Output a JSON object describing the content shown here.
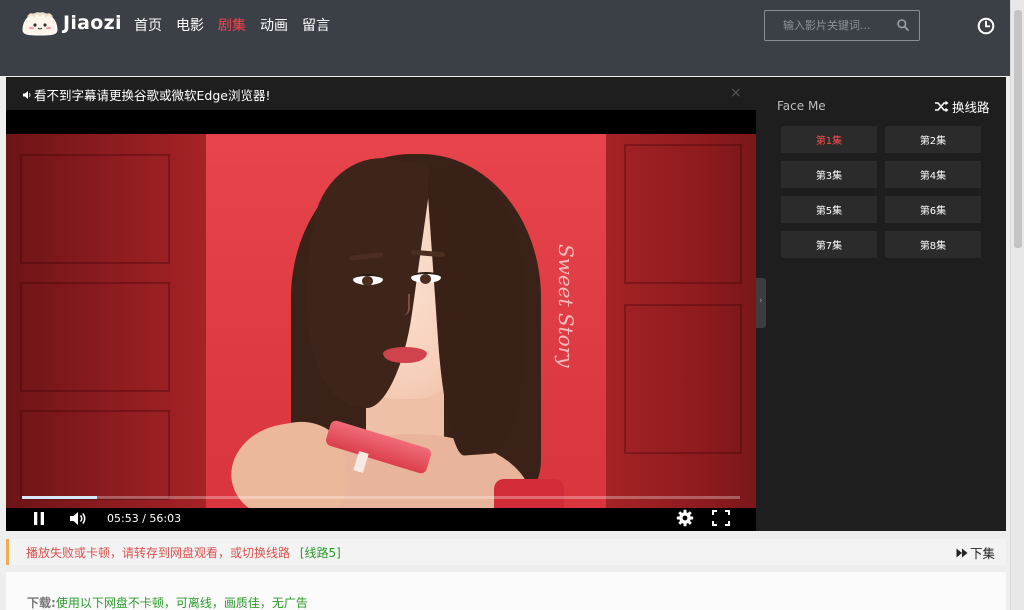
{
  "brand": {
    "name": "Jiaozi"
  },
  "nav": [
    {
      "label": "首页"
    },
    {
      "label": "电影"
    },
    {
      "label": "剧集"
    },
    {
      "label": "动画"
    },
    {
      "label": "留言"
    }
  ],
  "nav_active_index": 2,
  "search": {
    "placeholder": "输入影片关键词...",
    "value": ""
  },
  "player": {
    "notice": "看不到字幕请更换谷歌或微软Edge浏览器!",
    "close_glyph": "×",
    "current_time": "05:53",
    "time_separator": " / ",
    "duration": "56:03",
    "progress_fraction": 0.105,
    "state": "playing",
    "artwork_script": "Sweet Story"
  },
  "episode_panel": {
    "title": "Face Me",
    "switch_line_label": "换线路",
    "episodes": [
      {
        "label": "第1集"
      },
      {
        "label": "第2集"
      },
      {
        "label": "第3集"
      },
      {
        "label": "第4集"
      },
      {
        "label": "第5集"
      },
      {
        "label": "第6集"
      },
      {
        "label": "第7集"
      },
      {
        "label": "第8集"
      }
    ],
    "active_index": 0
  },
  "tip": {
    "text": "播放失败或卡顿，请转存到网盘观看，或切换线路",
    "link": "[线路5]",
    "next_label": "下集"
  },
  "download": {
    "label": "下载:",
    "text": "使用以下网盘不卡顿，可离线，画质佳，无广告"
  },
  "colors": {
    "header_bg": "#3a4046",
    "active_red": "#ff3e4a",
    "player_bg": "#1e1e1e",
    "tip_red": "#d9534f",
    "link_green": "#2b9a2b",
    "tip_border": "#f0ad4e"
  },
  "icons": {
    "search": "search-icon",
    "history": "clock-icon",
    "notice": "speaker-icon",
    "pause": "pause-icon",
    "volume": "volume-icon",
    "settings": "gear-icon",
    "fullscreen": "fullscreen-icon",
    "switch_line": "shuffle-icon",
    "next": "fast-forward-icon"
  }
}
